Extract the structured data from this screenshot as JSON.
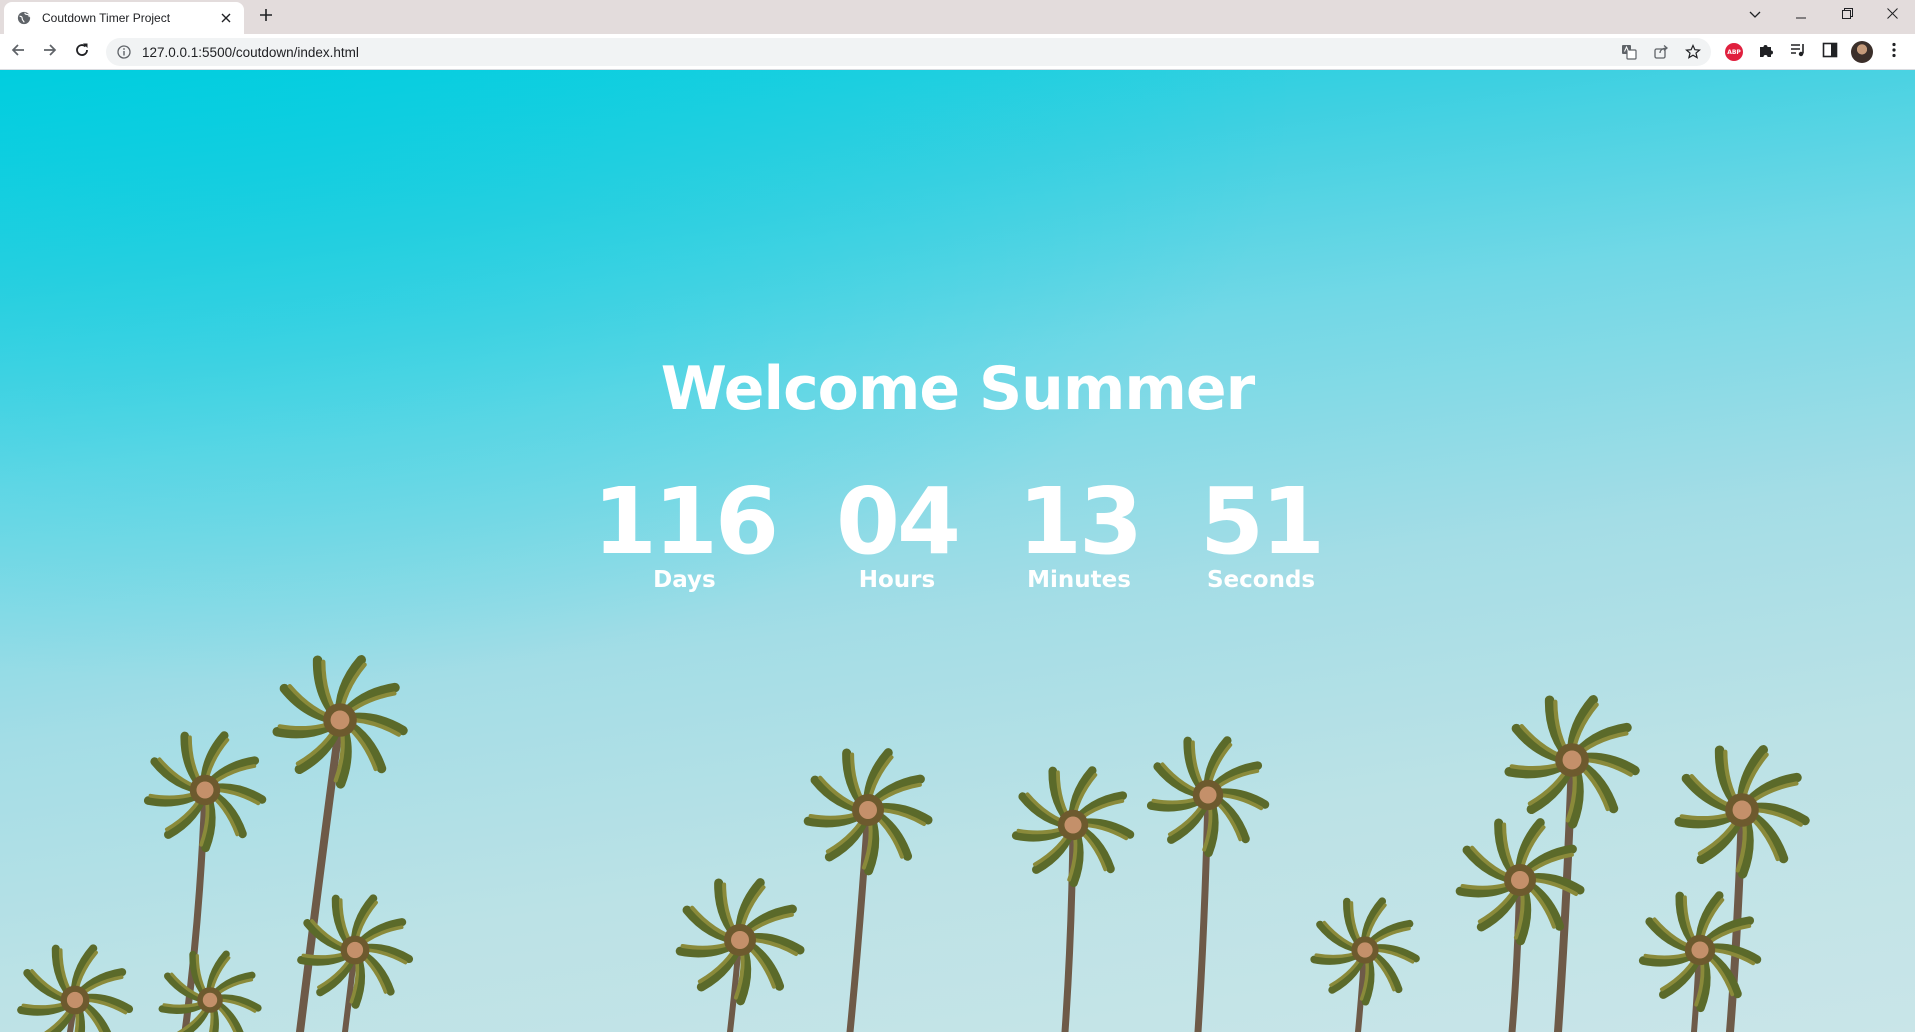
{
  "browser": {
    "tab_title": "Coutdown Timer Project",
    "url": "127.0.0.1:5500/coutdown/index.html",
    "abp_label": "ABP"
  },
  "page": {
    "heading": "Welcome Summer",
    "countdown": [
      {
        "value": "116",
        "label": "Days"
      },
      {
        "value": "04",
        "label": "Hours"
      },
      {
        "value": "13",
        "label": "Minutes"
      },
      {
        "value": "51",
        "label": "Seconds"
      }
    ]
  },
  "colors": {
    "text": "#ffffff",
    "sky_top": "#00cedf",
    "sky_bottom": "#c9e5e8",
    "tabstrip": "#e3dcdc"
  },
  "icons": {
    "tab_favicon": "globe-icon",
    "tab_close": "close-icon",
    "new_tab": "plus-icon",
    "window": [
      "tab-search-icon",
      "minimize-icon",
      "restore-icon",
      "window-close-icon"
    ],
    "nav": [
      "back-icon",
      "forward-icon",
      "reload-icon"
    ],
    "omnibox": [
      "site-info-icon",
      "translate-icon",
      "share-icon",
      "bookmark-star-icon"
    ],
    "extensions": [
      "abp-icon",
      "puzzle-icon",
      "media-icon",
      "side-panel-icon",
      "avatar",
      "kebab-menu-icon"
    ]
  }
}
